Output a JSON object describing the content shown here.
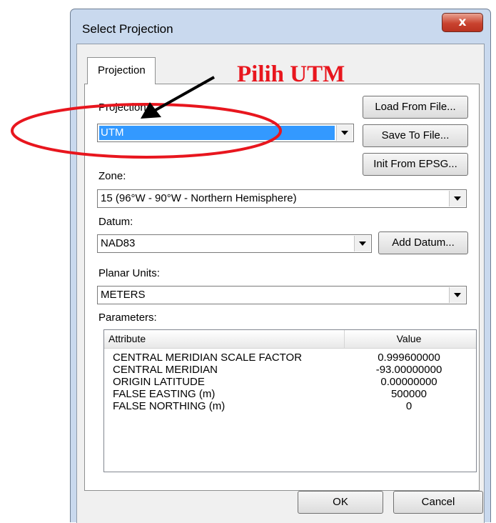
{
  "window": {
    "title": "Select Projection",
    "close_glyph": "x"
  },
  "tab": {
    "label": "Projection"
  },
  "projection": {
    "label": "Projection:",
    "value": "UTM"
  },
  "buttons": {
    "load_from_file": "Load From File...",
    "save_to_file": "Save To File...",
    "init_from_epsg": "Init From EPSG...",
    "add_datum": "Add Datum...",
    "ok": "OK",
    "cancel": "Cancel"
  },
  "zone": {
    "label": "Zone:",
    "value": "15 (96°W - 90°W - Northern Hemisphere)"
  },
  "datum": {
    "label": "Datum:",
    "value": "NAD83"
  },
  "planar_units": {
    "label": "Planar Units:",
    "value": "METERS"
  },
  "parameters": {
    "label": "Parameters:",
    "columns": [
      "Attribute",
      "Value"
    ],
    "rows": [
      {
        "attribute": "CENTRAL MERIDIAN SCALE FACTOR",
        "value": "0.999600000"
      },
      {
        "attribute": "CENTRAL MERIDIAN",
        "value": "-93.00000000"
      },
      {
        "attribute": "ORIGIN LATITUDE",
        "value": "0.00000000"
      },
      {
        "attribute": "FALSE EASTING (m)",
        "value": "500000"
      },
      {
        "attribute": "FALSE NORTHING (m)",
        "value": "0"
      }
    ]
  },
  "annotation": {
    "text": "Pilih UTM",
    "color": "#e8161e"
  },
  "colors": {
    "selection": "#3399ff",
    "close_button": "#c9432f",
    "window_frame": "#c9d9ee"
  },
  "icons": {
    "dropdown": "chevron-down-icon",
    "close": "close-icon"
  }
}
